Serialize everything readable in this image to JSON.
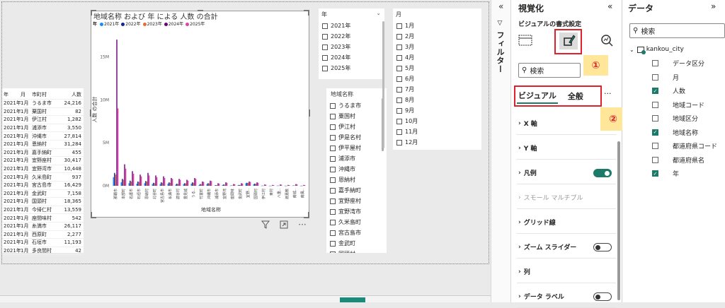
{
  "table": {
    "headers": [
      "年",
      "月",
      "市町村",
      "人数"
    ],
    "rows": [
      [
        "2021年",
        "1月",
        "うるま市",
        "24,216"
      ],
      [
        "2021年",
        "1月",
        "粟国村",
        "82"
      ],
      [
        "2021年",
        "1月",
        "伊江村",
        "1,282"
      ],
      [
        "2021年",
        "1月",
        "浦添市",
        "3,550"
      ],
      [
        "2021年",
        "1月",
        "沖縄市",
        "27,814"
      ],
      [
        "2021年",
        "1月",
        "恩納村",
        "31,284"
      ],
      [
        "2021年",
        "1月",
        "嘉手納町",
        "455"
      ],
      [
        "2021年",
        "1月",
        "宜野座村",
        "30,417"
      ],
      [
        "2021年",
        "1月",
        "宜野湾市",
        "10,448"
      ],
      [
        "2021年",
        "1月",
        "久米島町",
        "937"
      ],
      [
        "2021年",
        "1月",
        "宮古島市",
        "16,429"
      ],
      [
        "2021年",
        "1月",
        "金武町",
        "7,158"
      ],
      [
        "2021年",
        "1月",
        "国頭村",
        "18,365"
      ],
      [
        "2021年",
        "1月",
        "今帰仁村",
        "13,559"
      ],
      [
        "2021年",
        "1月",
        "座間味村",
        "542"
      ],
      [
        "2021年",
        "1月",
        "糸満市",
        "26,117"
      ],
      [
        "2021年",
        "1月",
        "西原町",
        "2,277"
      ],
      [
        "2021年",
        "1月",
        "石垣市",
        "11,193"
      ],
      [
        "2021年",
        "1月",
        "多良間村",
        "42"
      ]
    ]
  },
  "chart": {
    "title": "地域名称 および 年 による 人数 の合計",
    "legend_label": "年",
    "legend": [
      {
        "name": "2021年",
        "color": "#118dff"
      },
      {
        "name": "2022年",
        "color": "#12239e"
      },
      {
        "name": "2023年",
        "color": "#e66c37"
      },
      {
        "name": "2024年",
        "color": "#6b007b"
      },
      {
        "name": "2025年",
        "color": "#e044a7"
      }
    ],
    "ylabel": "人数 の合計",
    "xlabel": "地域名称",
    "yticks": [
      "15M",
      "10M",
      "5M",
      "0M"
    ]
  },
  "chart_data": {
    "type": "bar",
    "title": "地域名称 および 年 による 人数 の合計",
    "xlabel": "地域名称",
    "ylabel": "人数 の合計",
    "ylim": [
      0,
      17500000
    ],
    "categories": [
      "那覇市",
      "本部町",
      "名護市",
      "石垣市",
      "恩納村",
      "北谷町",
      "宮古島市",
      "糸満市",
      "読谷村",
      "豊見城",
      "うる..",
      "竹富町",
      "沖縄市",
      "浦添市",
      "宜野湾",
      "座間味",
      "金武町",
      "宜野..",
      "国頭村",
      "伊江村",
      "東村",
      "八重..",
      "渡嘉敷",
      "南城..",
      "南風.."
    ],
    "series": [
      {
        "name": "2021年",
        "values": [
          1000000,
          400000,
          300000,
          250000,
          300000,
          200000,
          200000,
          250000,
          150000,
          200000,
          250000,
          100000,
          200000,
          50000,
          100000,
          20000,
          70000,
          300000,
          180000,
          15000,
          10000,
          20000,
          10000,
          30000,
          10000
        ]
      },
      {
        "name": "2022年",
        "values": [
          1500000,
          800000,
          600000,
          500000,
          550000,
          350000,
          400000,
          400000,
          250000,
          300000,
          400000,
          200000,
          300000,
          80000,
          150000,
          40000,
          100000,
          350000,
          250000,
          25000,
          15000,
          30000,
          15000,
          40000,
          15000
        ]
      },
      {
        "name": "2023年",
        "values": [
          1300000,
          700000,
          500000,
          450000,
          500000,
          300000,
          350000,
          350000,
          200000,
          280000,
          350000,
          180000,
          280000,
          70000,
          130000,
          35000,
          90000,
          330000,
          220000,
          22000,
          12000,
          25000,
          12000,
          35000,
          12000
        ]
      },
      {
        "name": "2024年",
        "values": [
          17000000,
          2500000,
          1700000,
          1300000,
          1500000,
          1200000,
          1100000,
          900000,
          800000,
          700000,
          900000,
          500000,
          600000,
          300000,
          400000,
          200000,
          300000,
          500000,
          400000,
          150000,
          100000,
          150000,
          100000,
          200000,
          100000
        ]
      },
      {
        "name": "2025年",
        "values": [
          9000000,
          2000000,
          1400000,
          1100000,
          1200000,
          1000000,
          900000,
          800000,
          700000,
          600000,
          800000,
          450000,
          550000,
          250000,
          350000,
          180000,
          260000,
          450000,
          350000,
          120000,
          80000,
          130000,
          80000,
          170000,
          80000
        ]
      }
    ]
  },
  "year_slicer": {
    "title": "年",
    "items": [
      "2021年",
      "2022年",
      "2023年",
      "2024年",
      "2025年"
    ]
  },
  "month_slicer": {
    "title": "月",
    "items": [
      "1月",
      "2月",
      "3月",
      "4月",
      "5月",
      "6月",
      "7月",
      "8月",
      "9月",
      "10月",
      "11月",
      "12月"
    ]
  },
  "region_slicer": {
    "title": "地域名称",
    "items": [
      "うるま市",
      "粟国村",
      "伊江村",
      "伊是名村",
      "伊平屋村",
      "浦添市",
      "沖縄市",
      "恩納村",
      "嘉手納町",
      "宜野座村",
      "宜野湾市",
      "久米島町",
      "宮古島市",
      "金武町",
      "国頭村"
    ]
  },
  "filters_pane": {
    "label": "フィルター",
    "collapse_glyph": "«"
  },
  "viz_pane": {
    "title": "視覚化",
    "collapse_glyph": "«",
    "subtitle": "ビジュアルの書式設定",
    "badge1": "①",
    "badge2": "②",
    "search_placeholder": "検索",
    "tabs": [
      "ビジュアル",
      "全般"
    ],
    "more": "···",
    "sections": [
      {
        "label": "X 軸",
        "dim": false,
        "toggle": null
      },
      {
        "label": "Y 軸",
        "dim": false,
        "toggle": null
      },
      {
        "label": "凡例",
        "dim": false,
        "toggle": "on"
      },
      {
        "label": "スモール マルチプル",
        "dim": true,
        "toggle": null
      },
      {
        "label": "グリッド線",
        "dim": false,
        "toggle": null
      },
      {
        "label": "ズーム スライダー",
        "dim": false,
        "toggle": "off"
      },
      {
        "label": "列",
        "dim": false,
        "toggle": null
      },
      {
        "label": "データ ラベル",
        "dim": false,
        "toggle": "off"
      }
    ]
  },
  "data_pane": {
    "title": "データ",
    "collapse_glyph": "»",
    "search_placeholder": "検索",
    "table_name": "kankou_city",
    "fields": [
      {
        "label": "データ区分",
        "checked": false
      },
      {
        "label": "月",
        "checked": false
      },
      {
        "label": "人数",
        "checked": true
      },
      {
        "label": "地域コード",
        "checked": false
      },
      {
        "label": "地域区分",
        "checked": false
      },
      {
        "label": "地域名称",
        "checked": true
      },
      {
        "label": "都道府県コード",
        "checked": false
      },
      {
        "label": "都道府県名",
        "checked": false
      },
      {
        "label": "年",
        "checked": true
      }
    ]
  }
}
